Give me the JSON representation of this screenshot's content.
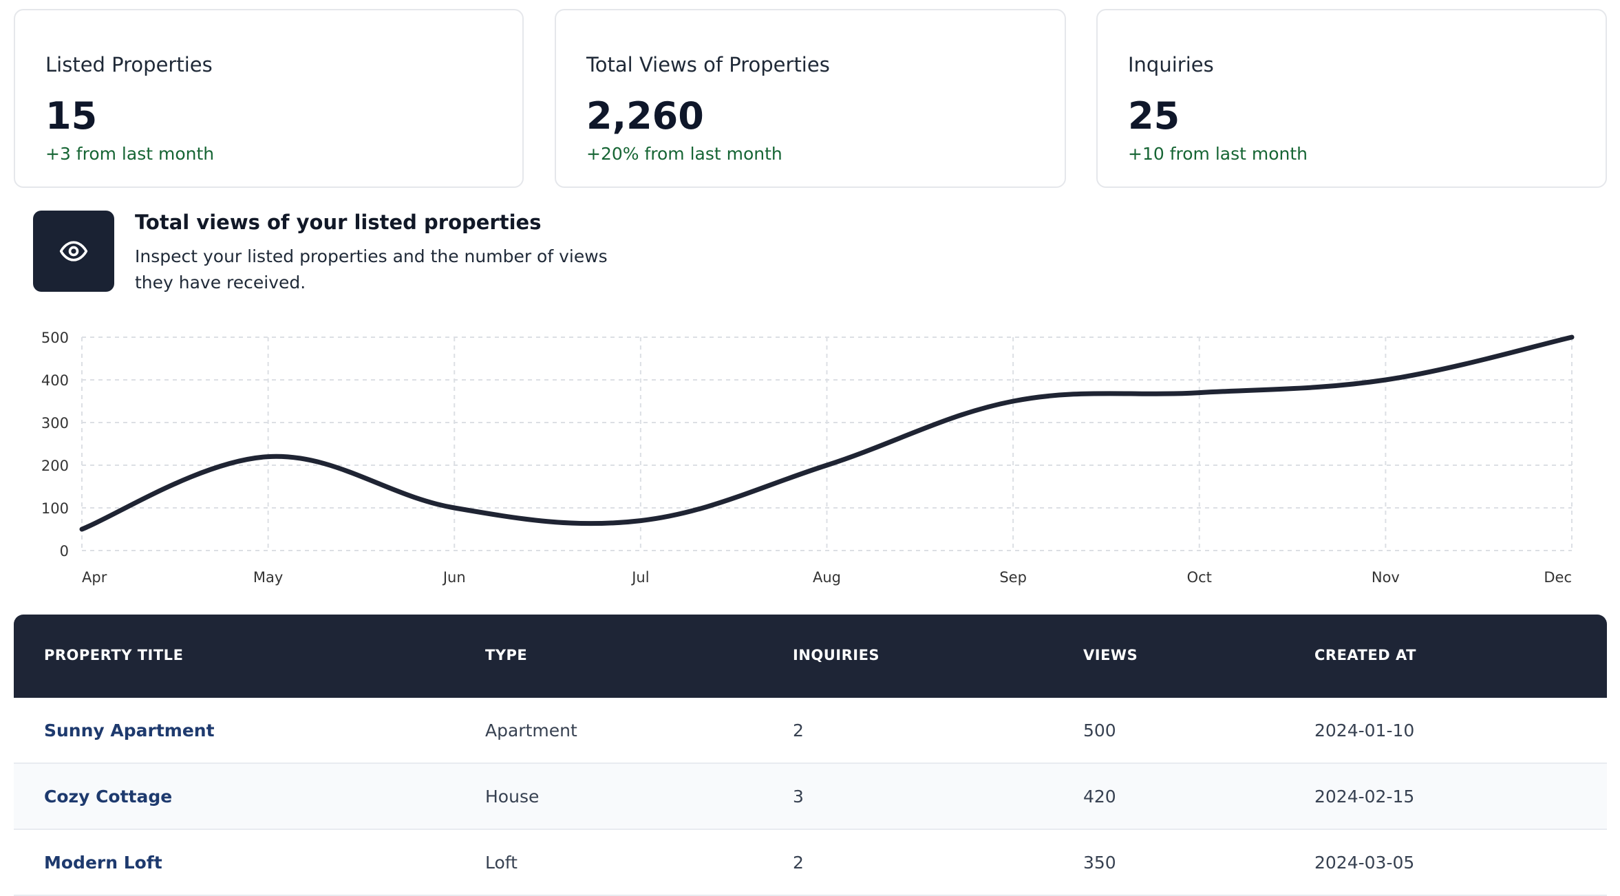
{
  "stats": [
    {
      "label": "Listed Properties",
      "value": "15",
      "delta": "+3 from last month"
    },
    {
      "label": "Total Views of Properties",
      "value": "2,260",
      "delta": "+20% from last month"
    },
    {
      "label": "Inquiries",
      "value": "25",
      "delta": "+10 from last month"
    }
  ],
  "views_section": {
    "icon": "eye-icon",
    "title": "Total views of your listed properties",
    "description": "Inspect your listed properties and the number of views they have received."
  },
  "chart_data": {
    "type": "line",
    "categories": [
      "Apr",
      "May",
      "Jun",
      "Jul",
      "Aug",
      "Sep",
      "Oct",
      "Nov",
      "Dec"
    ],
    "series": [
      {
        "values": [
          50,
          220,
          100,
          70,
          200,
          350,
          370,
          400,
          500
        ]
      }
    ],
    "ylim": [
      0,
      500
    ],
    "yticks": [
      0,
      100,
      200,
      300,
      400,
      500
    ],
    "grid": true,
    "line_color": "#1f2433"
  },
  "table": {
    "headers": [
      "PROPERTY TITLE",
      "TYPE",
      "INQUIRIES",
      "VIEWS",
      "CREATED AT"
    ],
    "rows": [
      {
        "title": "Sunny Apartment",
        "type": "Apartment",
        "inquiries": "2",
        "views": "500",
        "created_at": "2024-01-10"
      },
      {
        "title": "Cozy Cottage",
        "type": "House",
        "inquiries": "3",
        "views": "420",
        "created_at": "2024-02-15"
      },
      {
        "title": "Modern Loft",
        "type": "Loft",
        "inquiries": "2",
        "views": "350",
        "created_at": "2024-03-05"
      }
    ]
  }
}
